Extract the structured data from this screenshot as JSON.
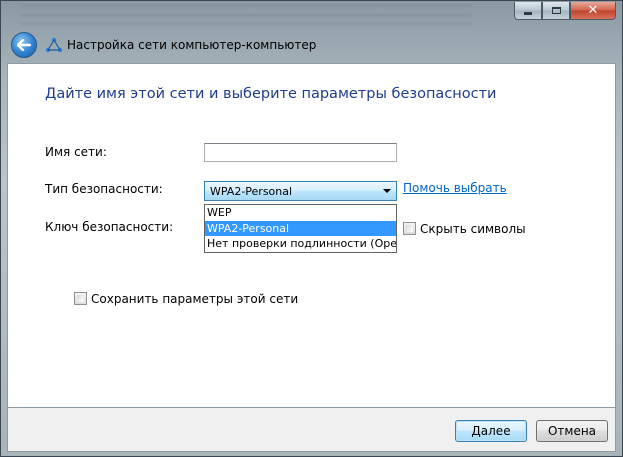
{
  "window": {
    "title": "Настройка сети компьютер-компьютер",
    "caption_close": "✕"
  },
  "page": {
    "heading": "Дайте имя этой сети и выберите параметры безопасности"
  },
  "form": {
    "network_name_label": "Имя сети:",
    "network_name_value": "",
    "security_type_label": "Тип безопасности:",
    "security_type_selected": "WPA2-Personal",
    "help_link": "Помочь выбрать",
    "security_key_label": "Ключ безопасности:",
    "hide_chars_label": "Скрыть символы",
    "hide_chars_checked": false,
    "save_settings_label": "Сохранить параметры этой сети",
    "save_settings_checked": false
  },
  "dropdown": {
    "options": [
      "WEP",
      "WPA2-Personal",
      "Нет проверки подлинности (Open)"
    ],
    "highlighted_index": 1
  },
  "footer": {
    "next_label": "Далее",
    "cancel_label": "Отмена"
  },
  "colors": {
    "heading": "#1f3c8e",
    "link": "#0066cc",
    "selection": "#3399ff"
  }
}
